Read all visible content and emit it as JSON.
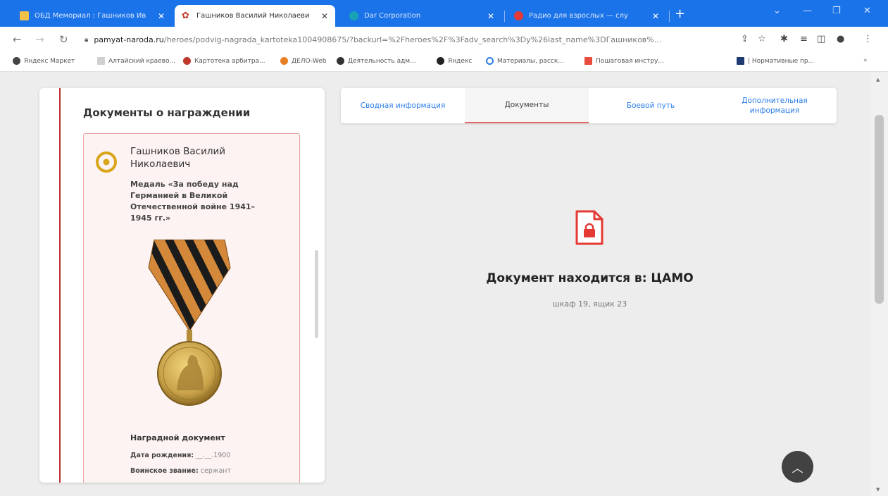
{
  "browser": {
    "tabs": [
      {
        "title": "ОБД Мемориал : Гашников Ив",
        "active": false
      },
      {
        "title": "Гашников Василий Николаеви",
        "active": true
      },
      {
        "title": "Dar Corporation",
        "active": false
      },
      {
        "title": "Радио для взрослых — слу",
        "active": false
      }
    ],
    "url_domain": "pamyat-naroda.ru",
    "url_path": "/heroes/podvig-nagrada_kartoteka1004908675/?backurl=%2Fheroes%2F%3Fadv_search%3Dy%26last_name%3DГашников%...",
    "bookmarks": [
      {
        "label": "Яндекс Маркет",
        "color": "#444444"
      },
      {
        "label": "Алтайский краево...",
        "color": "#cfcfcf"
      },
      {
        "label": "Картотека арбитра...",
        "color": "#c0392b"
      },
      {
        "label": "ДЕЛО-Web",
        "color": "#e67e22"
      },
      {
        "label": "Деятельность адм...",
        "color": "#333333"
      },
      {
        "label": "Яндекс",
        "color": "#222222"
      },
      {
        "label": "Материалы, расск...",
        "color": "#2b7de9"
      },
      {
        "label": "Пошаговая инстру...",
        "color": "#e74c3c"
      },
      {
        "label": "| Нормативные пр...",
        "color": "#1f3b73"
      }
    ]
  },
  "left": {
    "title": "Документы о награждении",
    "award": {
      "name": "Гашников Василий Николаевич",
      "medal": "Медаль «За победу над Германией в Великой Отечественной войне 1941–1945 гг.»",
      "doc_type": "Наградной документ",
      "birth_label": "Дата рождения:",
      "birth_value": "__.__.1900",
      "rank_label": "Воинское звание:",
      "rank_value": "сержант"
    }
  },
  "tabs": [
    {
      "label": "Сводная информация",
      "active": false
    },
    {
      "label": "Документы",
      "active": true
    },
    {
      "label": "Боевой путь",
      "active": false
    },
    {
      "label": "Дополнительная информация",
      "active": false
    }
  ],
  "document": {
    "location": "Документ находится в: ЦАМО",
    "details": "шкаф 19, ящик 23"
  },
  "colors": {
    "accent": "#2b7de9",
    "brand_red": "#e53935",
    "award_border": "#e6a6a6",
    "award_bg": "#fdf3f2"
  }
}
